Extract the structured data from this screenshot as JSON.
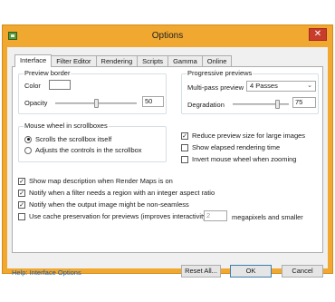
{
  "window": {
    "title": "Options"
  },
  "tabs": [
    "Interface",
    "Filter Editor",
    "Rendering",
    "Scripts",
    "Gamma",
    "Online"
  ],
  "preview_border": {
    "title": "Preview border",
    "color_label": "Color",
    "opacity_label": "Opacity",
    "opacity_value": "50"
  },
  "progressive": {
    "title": "Progressive previews",
    "multipass_label": "Multi-pass preview",
    "multipass_value": "4 Passes",
    "degradation_label": "Degradation",
    "degradation_value": "75"
  },
  "mouse_wheel": {
    "title": "Mouse wheel in scrollboxes",
    "option1": "Scrolls the scrollbox itself",
    "option2": "Adjusts the controls in the scrollbox"
  },
  "right_checks": [
    {
      "label": "Reduce preview size for large images",
      "checked": true
    },
    {
      "label": "Show elapsed rendering time",
      "checked": false
    },
    {
      "label": "Invert mouse wheel when zooming",
      "checked": false
    }
  ],
  "bottom_checks": [
    {
      "label": "Show map description when Render Maps is on",
      "checked": true
    },
    {
      "label": "Notify when a filter needs a region with an integer aspect ratio",
      "checked": true
    },
    {
      "label": "Notify when the output image might be non-seamless",
      "checked": true
    }
  ],
  "cache": {
    "label": "Use cache preservation for previews (improves interactivity):",
    "value": "2",
    "suffix": "megapixels and smaller"
  },
  "footer": {
    "help": "Help: Interface Options",
    "reset": "Reset All...",
    "ok": "OK",
    "cancel": "Cancel"
  }
}
